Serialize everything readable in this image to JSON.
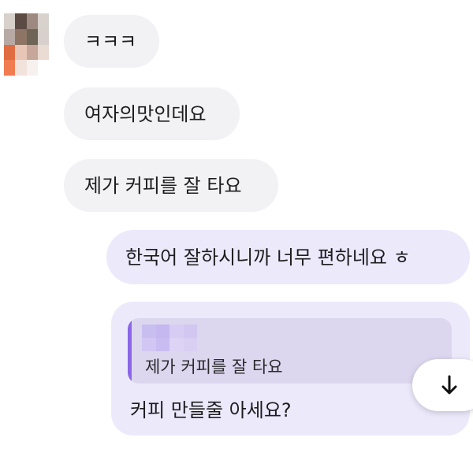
{
  "chat": {
    "incoming": [
      {
        "text": "ㅋㅋㅋ"
      },
      {
        "text": "여자의맛인데요"
      },
      {
        "text": "제가 커피를 잘 타요"
      }
    ],
    "outgoing": [
      {
        "text": "한국어 잘하시니까 너무 편하네요 ㅎ"
      }
    ],
    "reply": {
      "quoted_text": "제가 커피를 잘 타요",
      "text": "커피 만들줄 아세요?"
    }
  },
  "icons": {
    "scroll_down": "arrow-down-icon"
  },
  "colors": {
    "incoming_bubble": "#f2f2f4",
    "outgoing_bubble": "#ece9fb",
    "quote_card": "#dcd7ee",
    "quote_accent": "#8b66e6",
    "scroll_button": "#ffffff"
  }
}
